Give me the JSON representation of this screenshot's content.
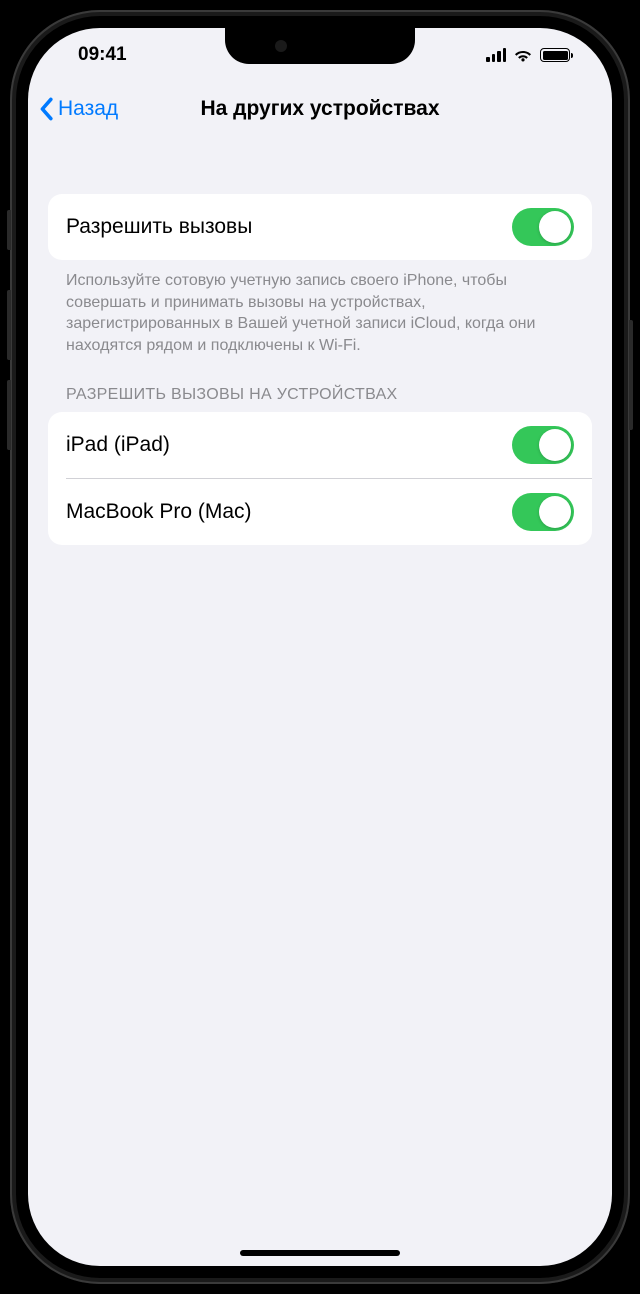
{
  "status": {
    "time": "09:41"
  },
  "nav": {
    "back_label": "Назад",
    "title": "На других устройствах"
  },
  "allow_calls": {
    "label": "Разрешить вызовы",
    "enabled": true,
    "footer": "Используйте сотовую учетную запись своего iPhone, чтобы совершать и принимать вызовы на устройствах, зарегистрированных в Вашей учетной записи iCloud, когда они находятся рядом и подключены к Wi-Fi."
  },
  "devices_section": {
    "header": "РАЗРЕШИТЬ ВЫЗОВЫ НА УСТРОЙСТВАХ",
    "items": [
      {
        "label": "iPad (iPad)",
        "enabled": true
      },
      {
        "label": "MacBook Pro (Mac)",
        "enabled": true
      }
    ]
  },
  "colors": {
    "accent": "#007aff",
    "toggle_on": "#34c759",
    "background": "#f2f2f7"
  }
}
